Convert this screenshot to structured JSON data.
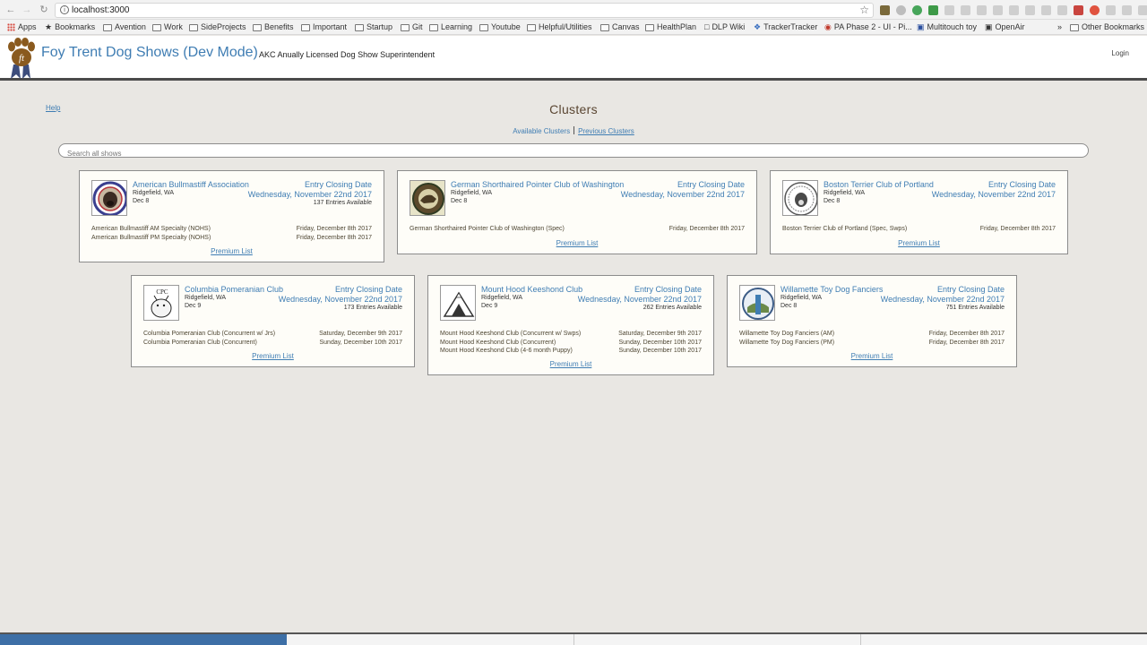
{
  "browser": {
    "url": "localhost:3000",
    "bookmarks": [
      "Apps",
      "Bookmarks",
      "Avention",
      "Work",
      "SideProjects",
      "Benefits",
      "Important",
      "Startup",
      "Git",
      "Learning",
      "Youtube",
      "Helpful/Utilities",
      "Canvas",
      "HealthPlan",
      "DLP Wiki",
      "TrackerTracker",
      "PA Phase 2 - UI - Pi...",
      "Multitouch toy",
      "OpenAir"
    ],
    "other_bookmarks": "Other Bookmarks",
    "overflow": "»"
  },
  "header": {
    "logo_text": "ft",
    "title": "Foy Trent Dog Shows (Dev Mode)",
    "subtitle": "AKC Anually Licensed Dog Show Superintendent",
    "login": "Login"
  },
  "page": {
    "help": "Help",
    "title": "Clusters",
    "tab_available": "Available Clusters",
    "tab_previous": "Previous Clusters",
    "search_placeholder": "Search all shows"
  },
  "cards": [
    {
      "name": "American Bullmastiff Association",
      "city": "Ridgefield, WA",
      "date": "Dec 8",
      "closing_label": "Entry Closing Date",
      "closing_date": "Wednesday, November 22nd 2017",
      "entries": "137 Entries Available",
      "shows": [
        {
          "name": "American Bullmastiff AM Specialty (NOHS)",
          "date": "Friday, December 8th 2017"
        },
        {
          "name": "American Bullmastiff PM Specialty (NOHS)",
          "date": "Friday, December 8th 2017"
        }
      ],
      "premium": "Premium List"
    },
    {
      "name": "German Shorthaired Pointer Club of Washington",
      "city": "Ridgefield, WA",
      "date": "Dec 8",
      "closing_label": "Entry Closing Date",
      "closing_date": "Wednesday, November 22nd 2017",
      "entries": "",
      "shows": [
        {
          "name": "German Shorthaired Pointer Club of Washington (Spec)",
          "date": "Friday, December 8th 2017"
        }
      ],
      "premium": "Premium List"
    },
    {
      "name": "Boston Terrier Club of Portland",
      "city": "Ridgefield, WA",
      "date": "Dec 8",
      "closing_label": "Entry Closing Date",
      "closing_date": "Wednesday, November 22nd 2017",
      "entries": "",
      "shows": [
        {
          "name": "Boston Terrier Club of Portland (Spec, Swps)",
          "date": "Friday, December 8th 2017"
        }
      ],
      "premium": "Premium List"
    },
    {
      "name": "Columbia Pomeranian Club",
      "city": "Ridgefield, WA",
      "date": "Dec 9",
      "closing_label": "Entry Closing Date",
      "closing_date": "Wednesday, November 22nd 2017",
      "entries": "173 Entries Available",
      "logo_text": "CPC",
      "shows": [
        {
          "name": "Columbia Pomeranian Club (Concurrent w/ Jrs)",
          "date": "Saturday, December 9th 2017"
        },
        {
          "name": "Columbia Pomeranian Club (Concurrent)",
          "date": "Sunday, December 10th 2017"
        }
      ],
      "premium": "Premium List"
    },
    {
      "name": "Mount Hood Keeshond Club",
      "city": "Ridgefield, WA",
      "date": "Dec 9",
      "closing_label": "Entry Closing Date",
      "closing_date": "Wednesday, November 22nd 2017",
      "entries": "262 Entries Available",
      "shows": [
        {
          "name": "Mount Hood Keeshond Club (Concurrent w/ Swps)",
          "date": "Saturday, December 9th 2017"
        },
        {
          "name": "Mount Hood Keeshond Club (Concurrent)",
          "date": "Sunday, December 10th 2017"
        },
        {
          "name": "Mount Hood Keeshond Club (4-6 month Puppy)",
          "date": "Sunday, December 10th 2017"
        }
      ],
      "premium": "Premium List"
    },
    {
      "name": "Willamette Toy Dog Fanciers",
      "city": "Ridgefield, WA",
      "date": "Dec 8",
      "closing_label": "Entry Closing Date",
      "closing_date": "Wednesday, November 22nd 2017",
      "entries": "751 Entries Available",
      "shows": [
        {
          "name": "Willamette Toy Dog Fanciers (AM)",
          "date": "Friday, December 8th 2017"
        },
        {
          "name": "Willamette Toy Dog Fanciers (PM)",
          "date": "Friday, December 8th 2017"
        }
      ],
      "premium": "Premium List"
    }
  ],
  "colors": {
    "accent": "#3f7db3",
    "background": "#e9e7e3",
    "card_bg": "#fefdf8",
    "header_rule": "#4a4a4a",
    "logo_brown": "#8a5a1e"
  }
}
